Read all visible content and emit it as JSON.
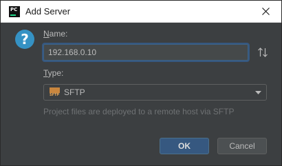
{
  "window": {
    "title": "Add Server",
    "app_icon_text": "PC"
  },
  "form": {
    "name_label": "Name:",
    "name_value": "192.168.0.10",
    "type_label": "Type:",
    "type_selected": "SFTP",
    "type_icon_tag": "SFTP",
    "hint": "Project files are deployed to a remote host via SFTP"
  },
  "buttons": {
    "ok": "OK",
    "cancel": "Cancel"
  },
  "icons": {
    "app": "pycharm-icon",
    "close": "close-icon",
    "question": "question-icon",
    "swap": "swap-icon",
    "type": "sftp-icon",
    "dropdown": "chevron-down-icon"
  },
  "colors": {
    "background": "#3c3f41",
    "accent": "#3592c4",
    "primary_button": "#365880",
    "text": "#bbbbbb"
  }
}
